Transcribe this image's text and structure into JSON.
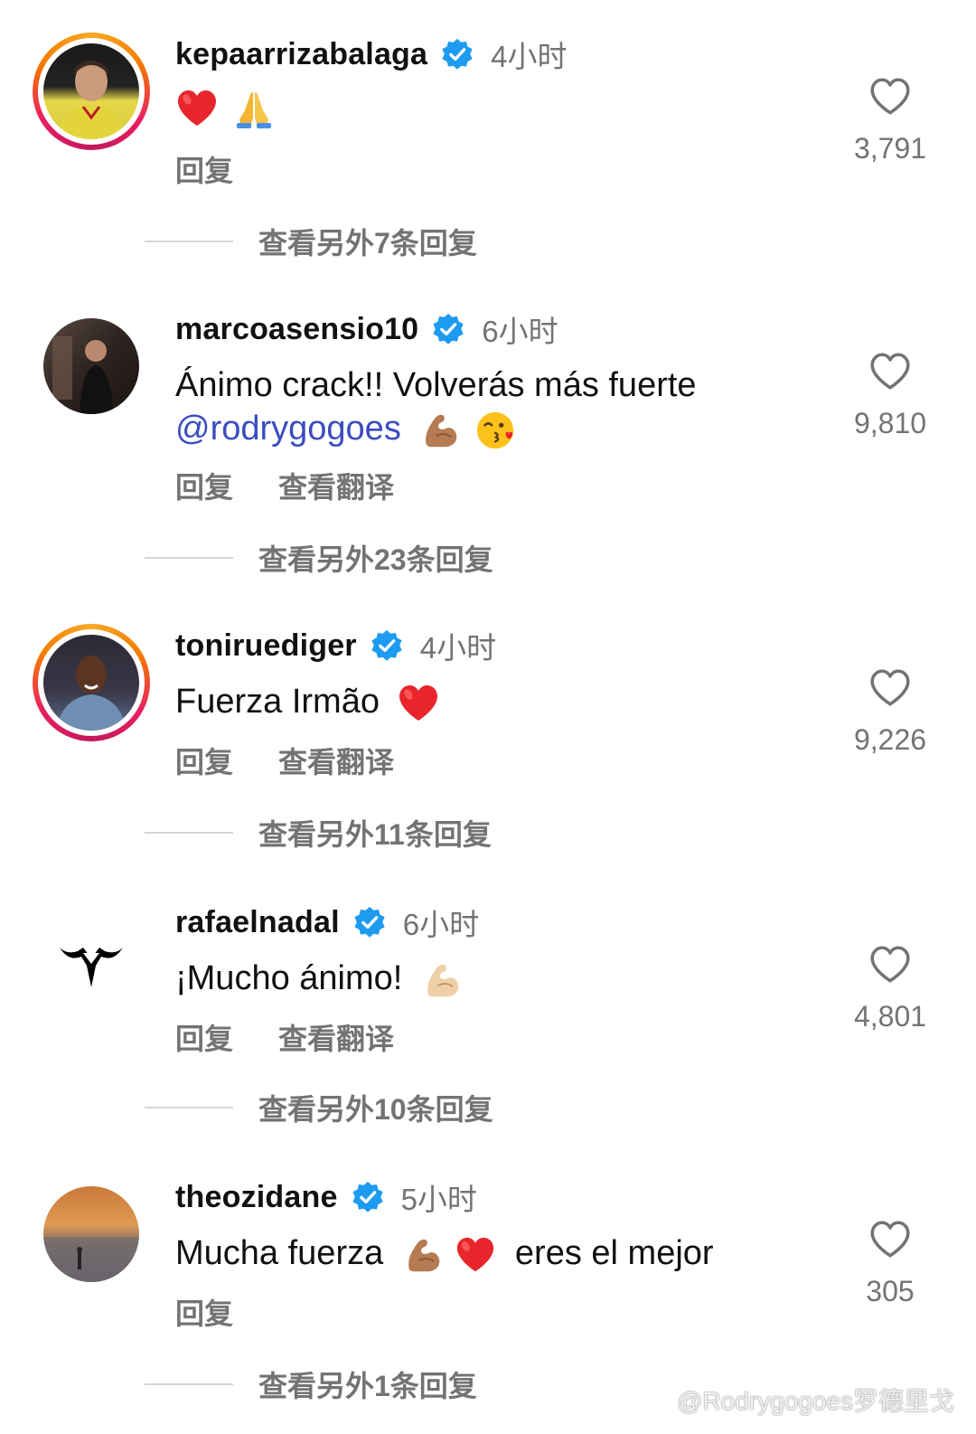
{
  "comments": [
    {
      "username": "kepaarrizabalaga",
      "time": "4小时",
      "text": "",
      "emojis": [
        "red-heart",
        "folded-hands"
      ],
      "actions": [
        "回复"
      ],
      "likes": "3,791",
      "more_replies": "查看另外7条回复",
      "story_ring": true
    },
    {
      "username": "marcoasensio10",
      "time": "6小时",
      "text_line1": "Ánimo crack!! Volverás más fuerte",
      "mention": "@rodrygogoes",
      "emojis": [
        "flexed-biceps",
        "face-blowing-kiss"
      ],
      "actions": [
        "回复",
        "查看翻译"
      ],
      "likes": "9,810",
      "more_replies": "查看另外23条回复",
      "story_ring": false
    },
    {
      "username": "toniruediger",
      "time": "4小时",
      "text": "Fuerza Irmão",
      "emojis": [
        "red-heart"
      ],
      "actions": [
        "回复",
        "查看翻译"
      ],
      "likes": "9,226",
      "more_replies": "查看另外11条回复",
      "story_ring": true
    },
    {
      "username": "rafaelnadal",
      "time": "6小时",
      "text": "¡Mucho ánimo!",
      "emojis": [
        "flexed-biceps"
      ],
      "actions": [
        "回复",
        "查看翻译"
      ],
      "likes": "4,801",
      "more_replies": "查看另外10条回复",
      "story_ring": false
    },
    {
      "username": "theozidane",
      "time": "5小时",
      "text_before": "Mucha fuerza",
      "text_after": "eres el mejor",
      "emojis": [
        "flexed-biceps",
        "red-heart"
      ],
      "actions": [
        "回复"
      ],
      "likes": "305",
      "more_replies": "查看另外1条回复",
      "story_ring": false
    }
  ],
  "watermark": "@Rodrygogoes罗德里戈",
  "colors": {
    "verified": "#1d9bf0",
    "secondary_text": "#737373",
    "mention": "#3b4cc0",
    "heart_emoji": "#e8252b"
  }
}
